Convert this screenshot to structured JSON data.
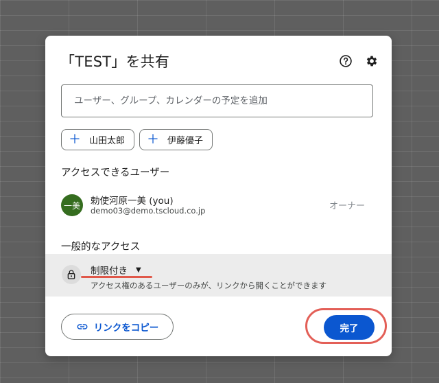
{
  "dialog": {
    "title": "「TEST」を共有",
    "help_icon": "help-circle-icon",
    "settings_icon": "gear-icon",
    "search_placeholder": "ユーザー、グループ、カレンダーの予定を追加",
    "suggestions": [
      {
        "label": "山田太郎",
        "icon": "plus-icon"
      },
      {
        "label": "伊藤優子",
        "icon": "plus-icon"
      }
    ],
    "people_heading": "アクセスできるユーザー",
    "owner": {
      "avatar_text": "一美",
      "name": "勅使河原一美 (you)",
      "email": "demo03@demo.tscloud.co.jp",
      "role": "オーナー"
    },
    "general_heading": "一般的なアクセス",
    "general_access": {
      "value": "制限付き",
      "description": "アクセス権のあるユーザーのみが、リンクから開くことができます",
      "icon": "lock-icon"
    },
    "copy_link_label": "リンクをコピー",
    "done_label": "完了",
    "colors": {
      "primary": "#0b57d0",
      "avatar": "#356d1f",
      "highlight": "#e35f57"
    }
  }
}
